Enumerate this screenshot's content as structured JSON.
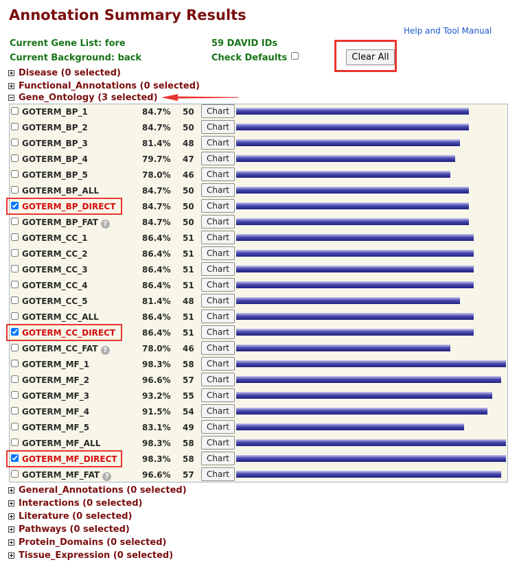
{
  "header": {
    "title": "Annotation Summary Results",
    "help_link": "Help and Tool Manual",
    "gene_list": "Current Gene List: fore",
    "background": "Current Background: back",
    "david_ids": "59 DAVID IDs",
    "check_defaults": "Check Defaults",
    "clear_all": "Clear All"
  },
  "categories_top": [
    {
      "label": "Disease (0 selected)"
    },
    {
      "label": "Functional_Annotations (0 selected)"
    },
    {
      "label": "Gene_Ontology (3 selected)"
    }
  ],
  "go_rows": [
    {
      "name": "GOTERM_BP_1",
      "pct": "84.7%",
      "count": "50",
      "chart": "Chart",
      "checked": false,
      "help": false,
      "share": 0.847
    },
    {
      "name": "GOTERM_BP_2",
      "pct": "84.7%",
      "count": "50",
      "chart": "Chart",
      "checked": false,
      "help": false,
      "share": 0.847
    },
    {
      "name": "GOTERM_BP_3",
      "pct": "81.4%",
      "count": "48",
      "chart": "Chart",
      "checked": false,
      "help": false,
      "share": 0.814
    },
    {
      "name": "GOTERM_BP_4",
      "pct": "79.7%",
      "count": "47",
      "chart": "Chart",
      "checked": false,
      "help": false,
      "share": 0.797
    },
    {
      "name": "GOTERM_BP_5",
      "pct": "78.0%",
      "count": "46",
      "chart": "Chart",
      "checked": false,
      "help": false,
      "share": 0.78
    },
    {
      "name": "GOTERM_BP_ALL",
      "pct": "84.7%",
      "count": "50",
      "chart": "Chart",
      "checked": false,
      "help": false,
      "share": 0.847
    },
    {
      "name": "GOTERM_BP_DIRECT",
      "pct": "84.7%",
      "count": "50",
      "chart": "Chart",
      "checked": true,
      "help": false,
      "share": 0.847
    },
    {
      "name": "GOTERM_BP_FAT",
      "pct": "84.7%",
      "count": "50",
      "chart": "Chart",
      "checked": false,
      "help": true,
      "share": 0.847
    },
    {
      "name": "GOTERM_CC_1",
      "pct": "86.4%",
      "count": "51",
      "chart": "Chart",
      "checked": false,
      "help": false,
      "share": 0.864
    },
    {
      "name": "GOTERM_CC_2",
      "pct": "86.4%",
      "count": "51",
      "chart": "Chart",
      "checked": false,
      "help": false,
      "share": 0.864
    },
    {
      "name": "GOTERM_CC_3",
      "pct": "86.4%",
      "count": "51",
      "chart": "Chart",
      "checked": false,
      "help": false,
      "share": 0.864
    },
    {
      "name": "GOTERM_CC_4",
      "pct": "86.4%",
      "count": "51",
      "chart": "Chart",
      "checked": false,
      "help": false,
      "share": 0.864
    },
    {
      "name": "GOTERM_CC_5",
      "pct": "81.4%",
      "count": "48",
      "chart": "Chart",
      "checked": false,
      "help": false,
      "share": 0.814
    },
    {
      "name": "GOTERM_CC_ALL",
      "pct": "86.4%",
      "count": "51",
      "chart": "Chart",
      "checked": false,
      "help": false,
      "share": 0.864
    },
    {
      "name": "GOTERM_CC_DIRECT",
      "pct": "86.4%",
      "count": "51",
      "chart": "Chart",
      "checked": true,
      "help": false,
      "share": 0.864
    },
    {
      "name": "GOTERM_CC_FAT",
      "pct": "78.0%",
      "count": "46",
      "chart": "Chart",
      "checked": false,
      "help": true,
      "share": 0.78
    },
    {
      "name": "GOTERM_MF_1",
      "pct": "98.3%",
      "count": "58",
      "chart": "Chart",
      "checked": false,
      "help": false,
      "share": 0.983
    },
    {
      "name": "GOTERM_MF_2",
      "pct": "96.6%",
      "count": "57",
      "chart": "Chart",
      "checked": false,
      "help": false,
      "share": 0.966
    },
    {
      "name": "GOTERM_MF_3",
      "pct": "93.2%",
      "count": "55",
      "chart": "Chart",
      "checked": false,
      "help": false,
      "share": 0.932
    },
    {
      "name": "GOTERM_MF_4",
      "pct": "91.5%",
      "count": "54",
      "chart": "Chart",
      "checked": false,
      "help": false,
      "share": 0.915
    },
    {
      "name": "GOTERM_MF_5",
      "pct": "83.1%",
      "count": "49",
      "chart": "Chart",
      "checked": false,
      "help": false,
      "share": 0.831
    },
    {
      "name": "GOTERM_MF_ALL",
      "pct": "98.3%",
      "count": "58",
      "chart": "Chart",
      "checked": false,
      "help": false,
      "share": 0.983
    },
    {
      "name": "GOTERM_MF_DIRECT",
      "pct": "98.3%",
      "count": "58",
      "chart": "Chart",
      "checked": true,
      "help": false,
      "share": 0.983
    },
    {
      "name": "GOTERM_MF_FAT",
      "pct": "96.6%",
      "count": "57",
      "chart": "Chart",
      "checked": false,
      "help": true,
      "share": 0.966
    }
  ],
  "categories_bottom": [
    {
      "label": "General_Annotations (0 selected)"
    },
    {
      "label": "Interactions (0 selected)"
    },
    {
      "label": "Literature (0 selected)"
    },
    {
      "label": "Pathways (0 selected)"
    },
    {
      "label": "Protein_Domains (0 selected)"
    },
    {
      "label": "Tissue_Expression (0 selected)"
    }
  ],
  "help_icon_glyph": "?",
  "colors": {
    "title": "#7a0d0d",
    "info_green": "#167316",
    "link_blue": "#1a57c9",
    "selected_red": "#d40c0c",
    "highlight_red": "#e8342f",
    "panel_bg": "#f7f6e9",
    "bar_blue": "#3a3aa0"
  }
}
